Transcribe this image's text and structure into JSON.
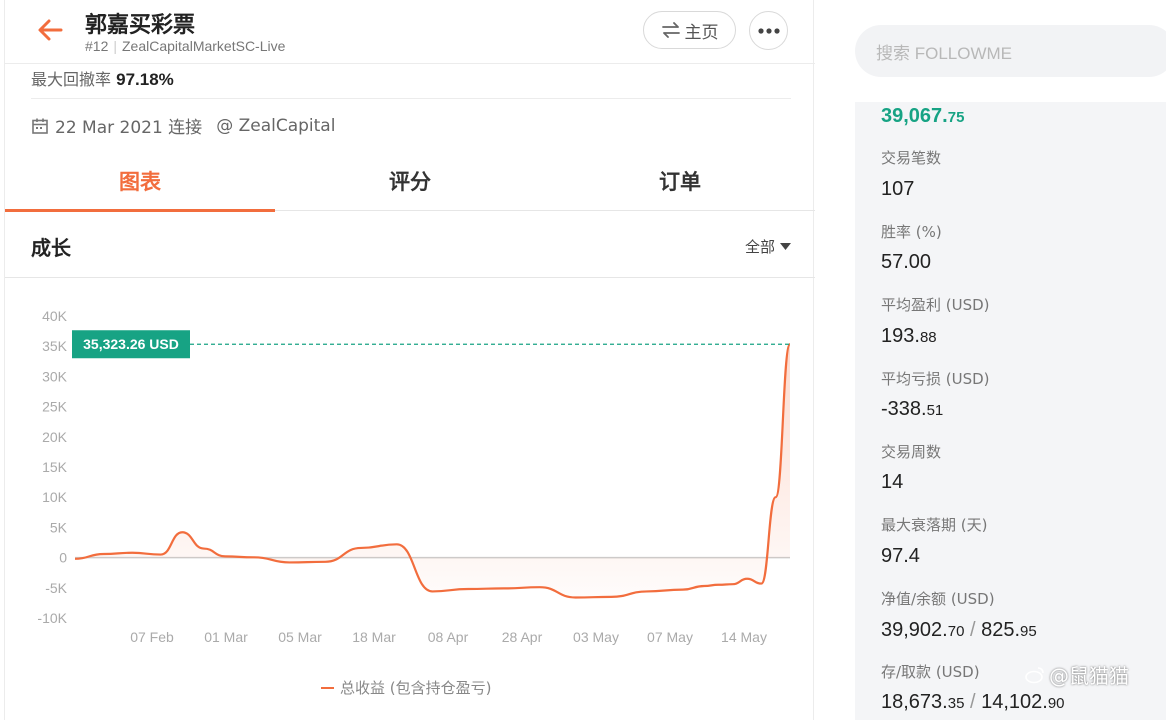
{
  "header": {
    "title": "郭嘉买彩票",
    "rank": "#12",
    "account": "ZealCapitalMarketSC-Live",
    "home_label": "主页"
  },
  "profile": {
    "drawdown_label": "最大回撤率",
    "drawdown_value": "97.18%",
    "connect_date": "22 Mar 2021 连接",
    "broker": "@ ZealCapital"
  },
  "tabs": [
    {
      "label": "图表",
      "active": true
    },
    {
      "label": "评分",
      "active": false
    },
    {
      "label": "订单",
      "active": false
    }
  ],
  "section": {
    "title": "成长",
    "filter_label": "全部"
  },
  "chart_data": {
    "type": "area",
    "title": "",
    "xlabel": "",
    "ylabel": "",
    "ylim": [
      -10000,
      40000
    ],
    "yticks": [
      "40K",
      "35K",
      "30K",
      "25K",
      "20K",
      "15K",
      "10K",
      "5K",
      "0",
      "-5K",
      "-10K"
    ],
    "xticks": [
      "07 Feb",
      "01 Mar",
      "05 Mar",
      "18 Mar",
      "08 Apr",
      "28 Apr",
      "03 May",
      "07 May",
      "14 May"
    ],
    "current_label": "35,323.26 USD",
    "current_value": 35323.26,
    "series": [
      {
        "name": "总收益 (包含持仓盈亏)",
        "color": "#f26d3d",
        "x": [
          0,
          0.4,
          0.8,
          1.2,
          1.5,
          1.8,
          2.1,
          2.5,
          3.0,
          3.5,
          4.0,
          4.5,
          5.0,
          5.5,
          6.0,
          6.5,
          7.0,
          7.5,
          8.0,
          8.5,
          8.8,
          9.0,
          9.2,
          9.4,
          9.6,
          9.8,
          10.0
        ],
        "values": [
          -200,
          600,
          800,
          500,
          4200,
          1500,
          200,
          50,
          -800,
          -700,
          1600,
          2200,
          -5600,
          -5200,
          -5100,
          -4900,
          -6600,
          -6500,
          -5600,
          -5300,
          -4700,
          -4500,
          -4400,
          -3500,
          -4300,
          10000,
          35323.26
        ]
      }
    ]
  },
  "search": {
    "placeholder": "搜索 FOLLOWME"
  },
  "stats": {
    "top_value_main": "39,067.",
    "top_value_small": "75",
    "trades_label": "交易笔数",
    "trades_value": "107",
    "winrate_label": "胜率 (%)",
    "winrate_value": "57.00",
    "avg_profit_label": "平均盈利 (USD)",
    "avg_profit_main": "193.",
    "avg_profit_small": "88",
    "avg_loss_label": "平均亏损 (USD)",
    "avg_loss_main": "-338.",
    "avg_loss_small": "51",
    "weeks_label": "交易周数",
    "weeks_value": "14",
    "max_decline_label": "最大衰落期 (天)",
    "max_decline_value": "97.4",
    "equity_label": "净值/余额 (USD)",
    "equity_main": "39,902.",
    "equity_small": "70",
    "balance_main": "825.",
    "balance_small": "95",
    "deposit_label": "存/取款 (USD)",
    "deposit_main": "18,673.",
    "deposit_small": "35",
    "withdraw_main": "14,102.",
    "withdraw_small": "90"
  },
  "watermark": "@鼠猫猫"
}
